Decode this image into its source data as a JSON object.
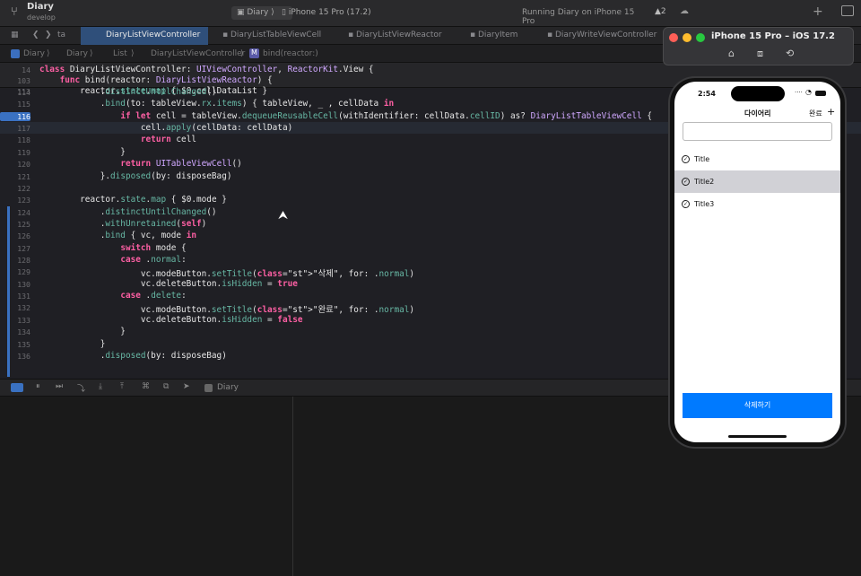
{
  "titlebar": {
    "project": "Diary",
    "branch": "develop",
    "scheme": "Diary",
    "device": "iPhone 15 Pro (17.2)",
    "status": "Running Diary on iPhone 15 Pro",
    "warnings": "2"
  },
  "tabs": [
    {
      "label": "DiaryListViewController"
    },
    {
      "label": "DiaryListTableViewCell"
    },
    {
      "label": "DiaryListViewReactor"
    },
    {
      "label": "DiaryItem"
    },
    {
      "label": "DiaryWriteViewController"
    }
  ],
  "tab_fragment": "ta",
  "breadcrumb": {
    "p1": "Diary",
    "p2": "Diary",
    "p3": "List",
    "p4": "DiaryListViewController",
    "p5": "bind(reactor:)"
  },
  "code": {
    "l0n": "14",
    "l0": "class DiaryListViewController: UIViewController, ReactorKit.View {",
    "l1n": "103",
    "l1": "    func bind(reactor: DiaryListViewReactor) {",
    "l2n": "113",
    "l2": "        reactor.state.map { $0.cellDataList }",
    "l3n": "114",
    "l3": "            .distinctUntilChanged()",
    "l4n": "115",
    "l4": "            .bind(to: tableView.rx.items) { tableView, _ , cellData in",
    "l5n": "116",
    "l5": "                if let cell = tableView.dequeueReusableCell(withIdentifier: cellData.cellID) as? DiaryListTableViewCell {",
    "l6n": "117",
    "l6": "                    cell.apply(cellData: cellData)",
    "l7n": "118",
    "l7": "                    return cell",
    "l8n": "119",
    "l8": "                }",
    "l9n": "120",
    "l9": "                return UITableViewCell()",
    "l10n": "121",
    "l10": "            }.disposed(by: disposeBag)",
    "l11n": "122",
    "l11": "",
    "l12n": "123",
    "l12": "        reactor.state.map { $0.mode }",
    "l13n": "124",
    "l13": "            .distinctUntilChanged()",
    "l14n": "125",
    "l14": "            .withUnretained(self)",
    "l15n": "126",
    "l15": "            .bind { vc, mode in",
    "l16n": "127",
    "l16": "                switch mode {",
    "l17n": "128",
    "l17": "                case .normal:",
    "l18n": "129",
    "l18": "                    vc.modeButton.setTitle(\"삭제\", for: .normal)",
    "l19n": "130",
    "l19": "                    vc.deleteButton.isHidden = true",
    "l20n": "131",
    "l20": "                case .delete:",
    "l21n": "132",
    "l21": "                    vc.modeButton.setTitle(\"완료\", for: .normal)",
    "l22n": "133",
    "l22": "                    vc.deleteButton.isHidden = false",
    "l23n": "134",
    "l23": "                }",
    "l24n": "135",
    "l24": "            }",
    "l25n": "136",
    "l25": "            .disposed(by: disposeBag)"
  },
  "debugbar": {
    "target": "Diary"
  },
  "simulator": {
    "title": "iPhone 15 Pro – iOS 17.2"
  },
  "app": {
    "time": "2:54",
    "nav_title": "다이어리",
    "done_button": "완료",
    "add_button": "+",
    "search_placeholder": "",
    "items": [
      {
        "title": "Title"
      },
      {
        "title": "Title2"
      },
      {
        "title": "Title3"
      }
    ],
    "delete_button": "삭제하기"
  },
  "colors": {
    "accent": "#007aff",
    "selected_row": "#d1d1d6",
    "keyword": "#fc5fa3"
  }
}
